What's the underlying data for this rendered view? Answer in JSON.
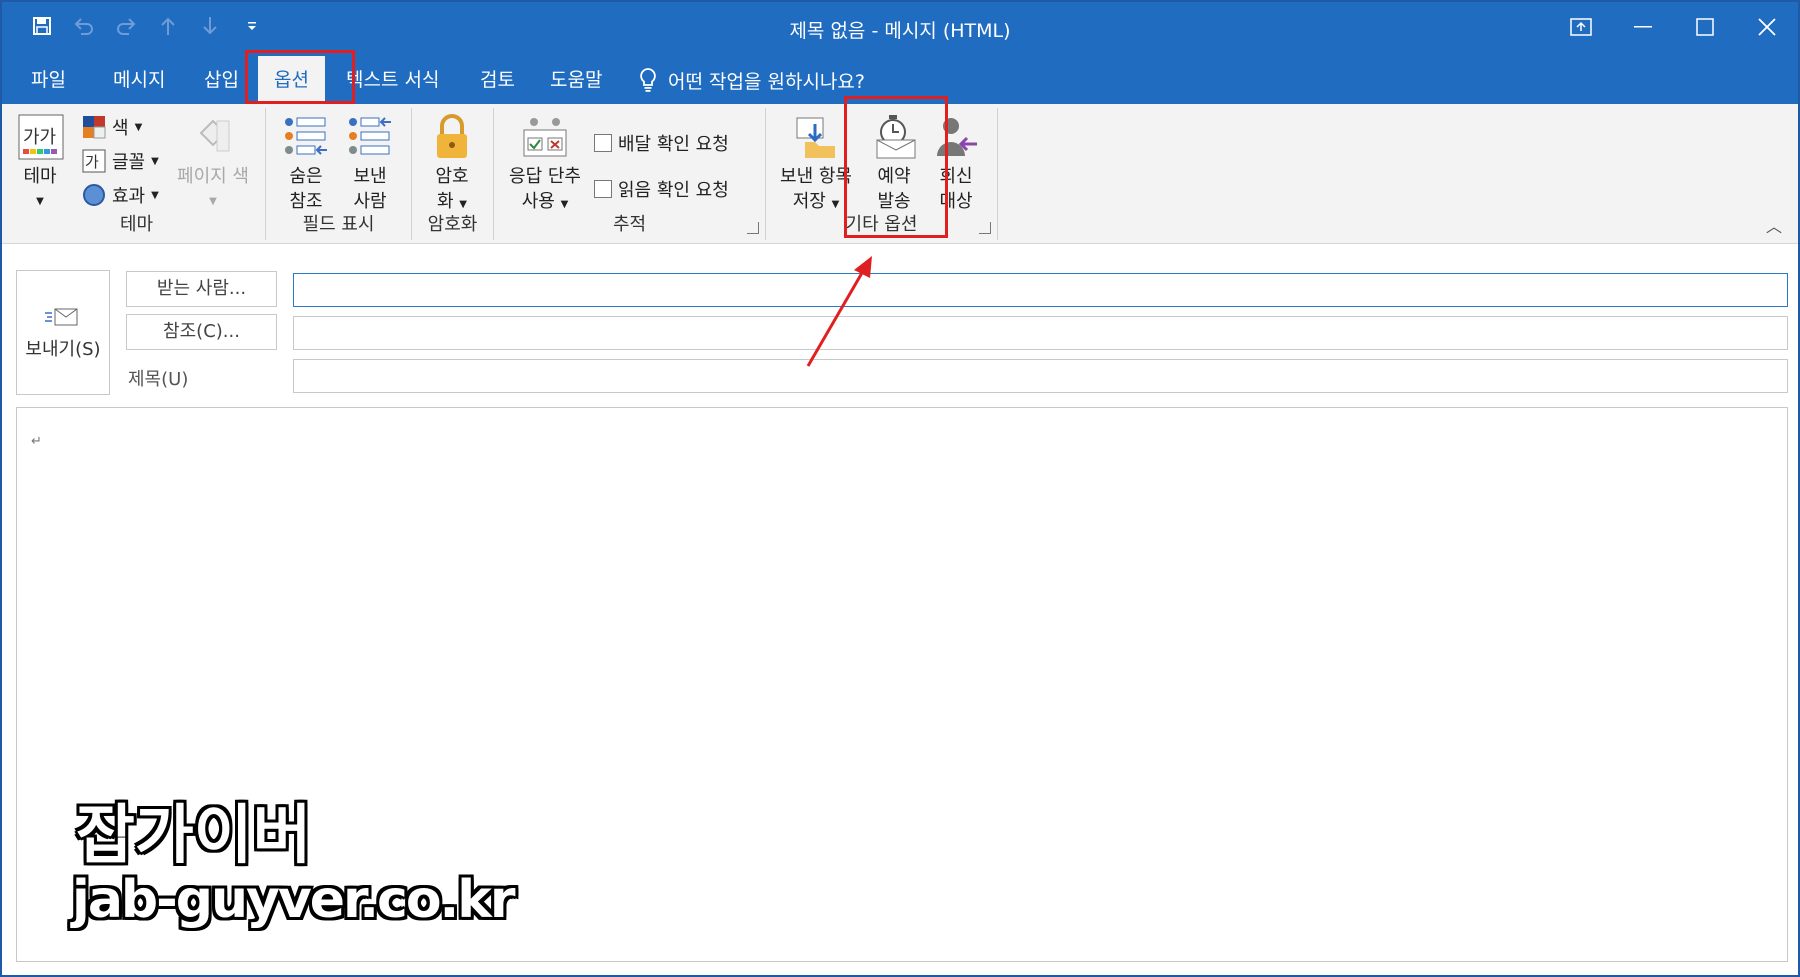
{
  "window": {
    "title": "제목 없음  -  메시지 (HTML)",
    "qat_icons": [
      "save-icon",
      "undo-icon",
      "redo-icon",
      "arrow-up-icon",
      "arrow-down-icon",
      "customize-icon"
    ]
  },
  "tabs": [
    {
      "label": "파일"
    },
    {
      "label": "메시지"
    },
    {
      "label": "삽입"
    },
    {
      "label": "옵션",
      "active": true
    },
    {
      "label": "텍스트 서식"
    },
    {
      "label": "검토"
    },
    {
      "label": "도움말"
    }
  ],
  "tell_me": "어떤 작업을 원하시나요?",
  "ribbon": {
    "theme_group": {
      "label": "테마",
      "theme_button": "테마",
      "color": "색",
      "font": "글꼴",
      "effects": "효과",
      "page_color": "페이지 색"
    },
    "fields_group": {
      "label": "필드 표시",
      "bcc_line1": "숨은",
      "bcc_line2": "참조",
      "from_line1": "보낸",
      "from_line2": "사람"
    },
    "encrypt_group": {
      "label": "암호화",
      "encrypt_line1": "암호",
      "encrypt_line2": "화"
    },
    "tracking_group": {
      "label": "추적",
      "voting_line1": "응답 단추",
      "voting_line2": "사용",
      "delivery_receipt": "배달 확인 요청",
      "read_receipt": "읽음 확인 요청"
    },
    "more_options_group": {
      "label": "기타 옵션",
      "save_sent_line1": "보낸 항목",
      "save_sent_line2": "저장",
      "delay_line1": "예약",
      "delay_line2": "발송",
      "reply_line1": "회신",
      "reply_line2": "대상"
    }
  },
  "compose": {
    "send_label": "보내기(S)",
    "to_label": "받는 사람...",
    "cc_label": "참조(C)...",
    "subject_label": "제목(U)",
    "to_value": "",
    "cc_value": "",
    "subject_value": "",
    "body_mark": "↵"
  },
  "watermark": {
    "name": "잡가이버",
    "url": "jab-guyver.co.kr"
  },
  "colors": {
    "titlebar": "#1f6cc0",
    "ribbon_bg": "#f3f3f3",
    "highlight": "#e02020"
  }
}
